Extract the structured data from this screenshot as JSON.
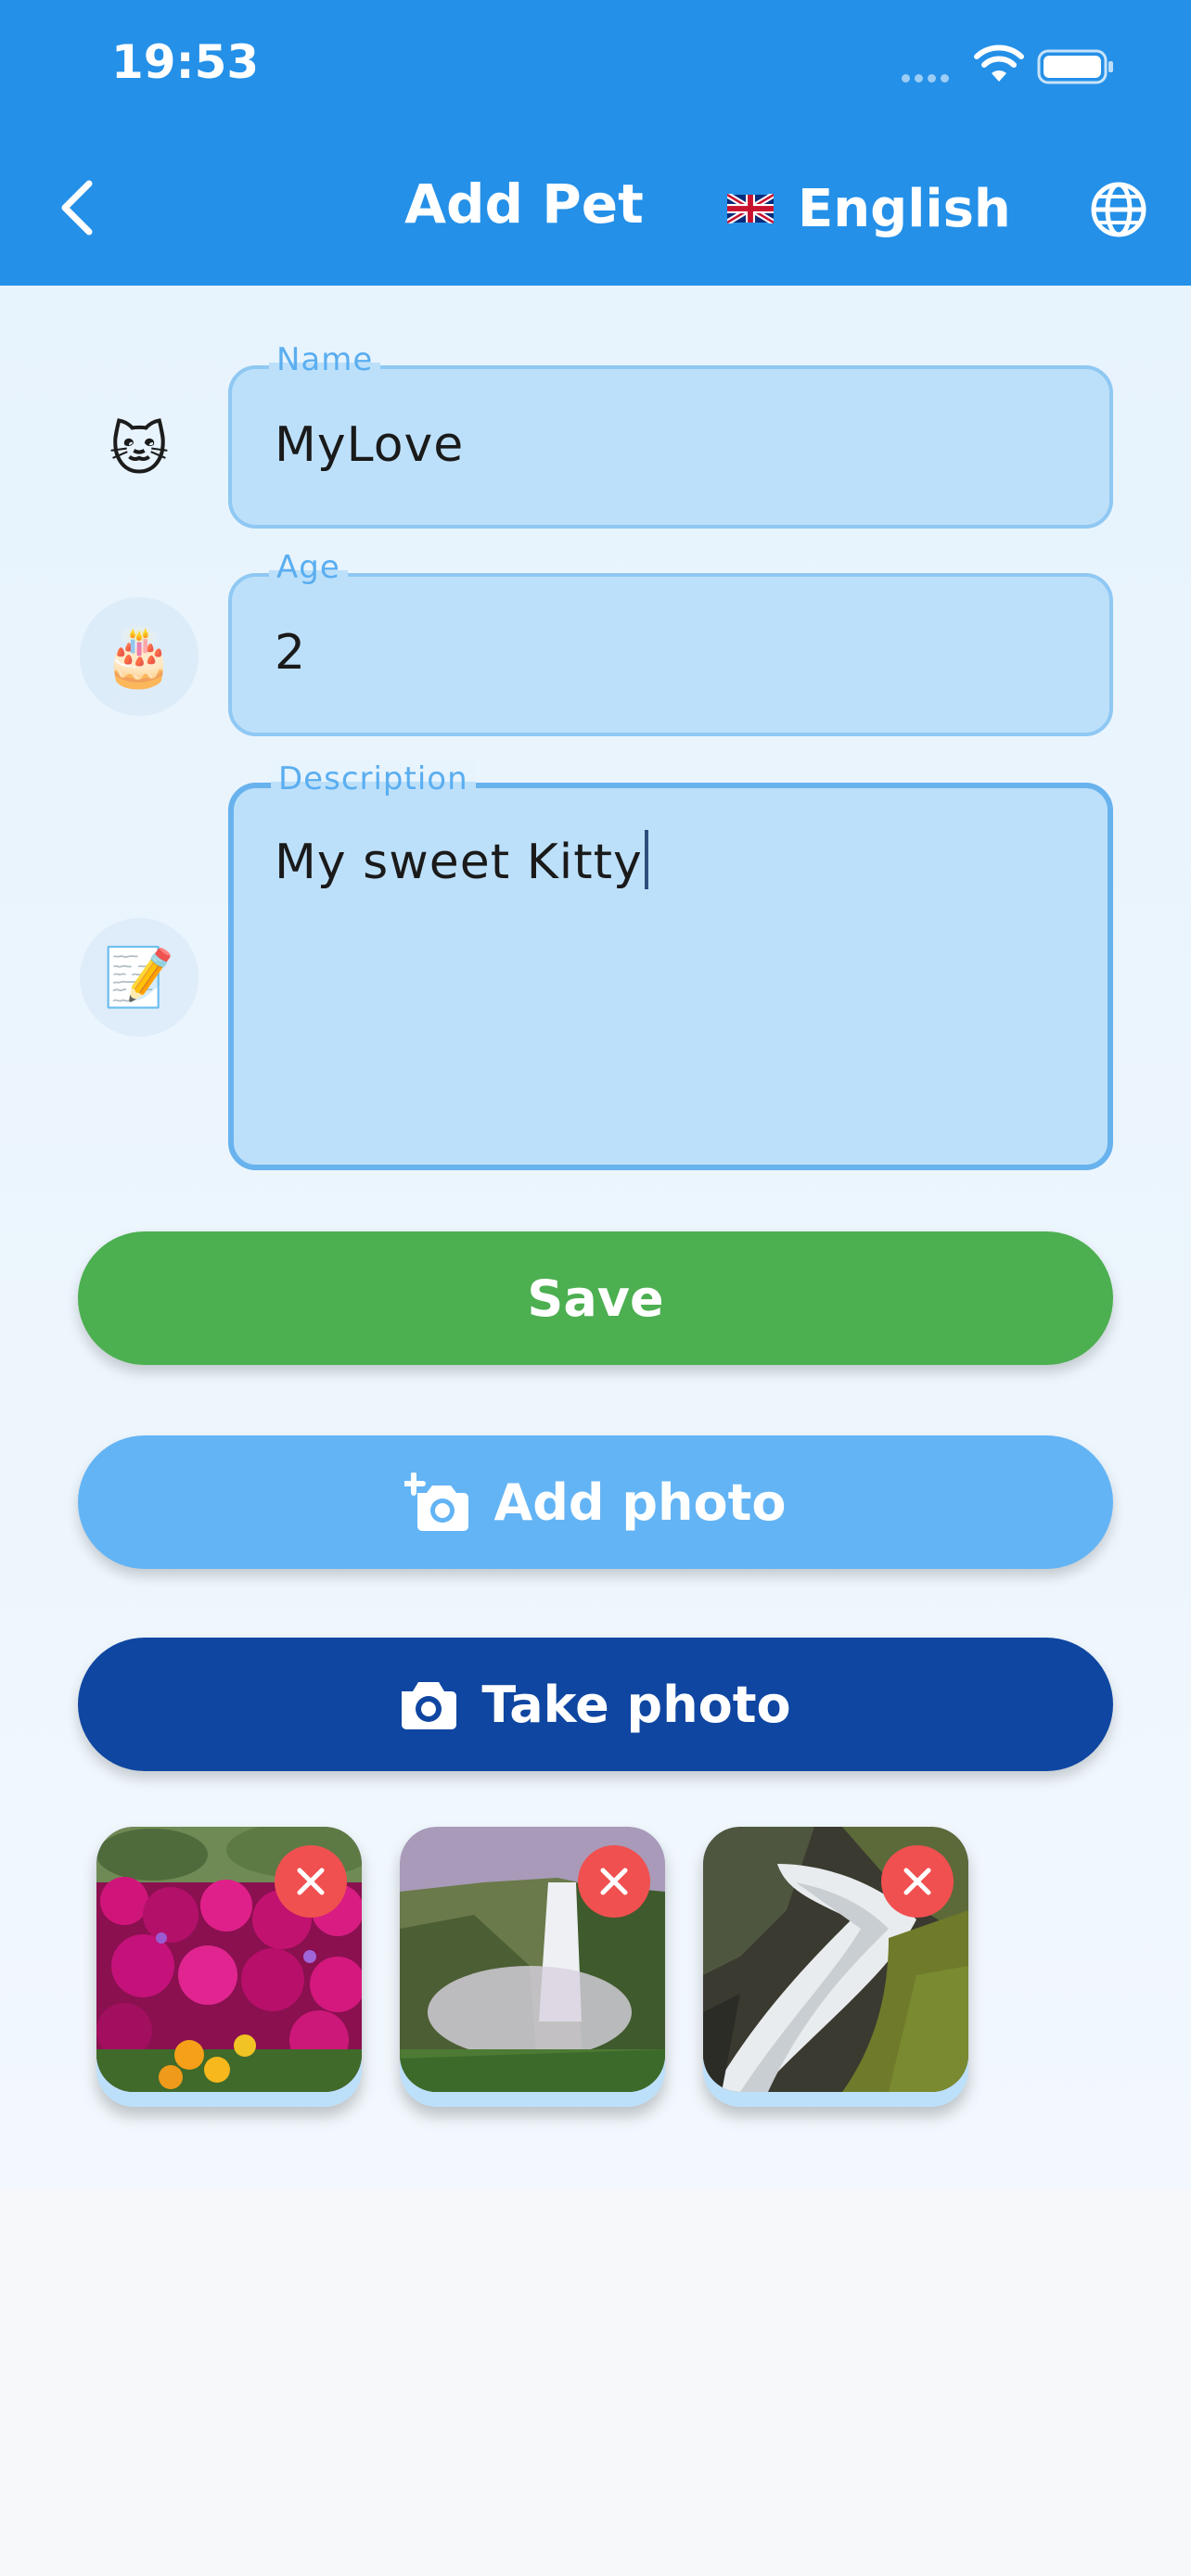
{
  "status_bar": {
    "time": "19:53"
  },
  "header": {
    "title": "Add Pet",
    "language": "English",
    "flag": "uk-flag-icon",
    "background": "#2490e8"
  },
  "form": {
    "name": {
      "label": "Name",
      "value": "MyLove",
      "icon": "🐱"
    },
    "age": {
      "label": "Age",
      "value": "2",
      "icon": "🎂"
    },
    "description": {
      "label": "Description",
      "value": "My sweet Kitty",
      "icon": "📝"
    }
  },
  "buttons": {
    "save": "Save",
    "add_photo": "Add photo",
    "take_photo": "Take photo"
  },
  "photos": [
    {
      "subject": "pink and magenta flowers",
      "icon": "remove-photo-icon"
    },
    {
      "subject": "misty waterfall",
      "icon": "remove-photo-icon"
    },
    {
      "subject": "cascading waterfall over mossy rocks",
      "icon": "remove-photo-icon"
    }
  ],
  "colors": {
    "save": "#4caf50",
    "add_photo": "#63b4f5",
    "take_photo": "#0f46a1",
    "remove": "#f05050",
    "field_bg": "#bde0fa"
  }
}
